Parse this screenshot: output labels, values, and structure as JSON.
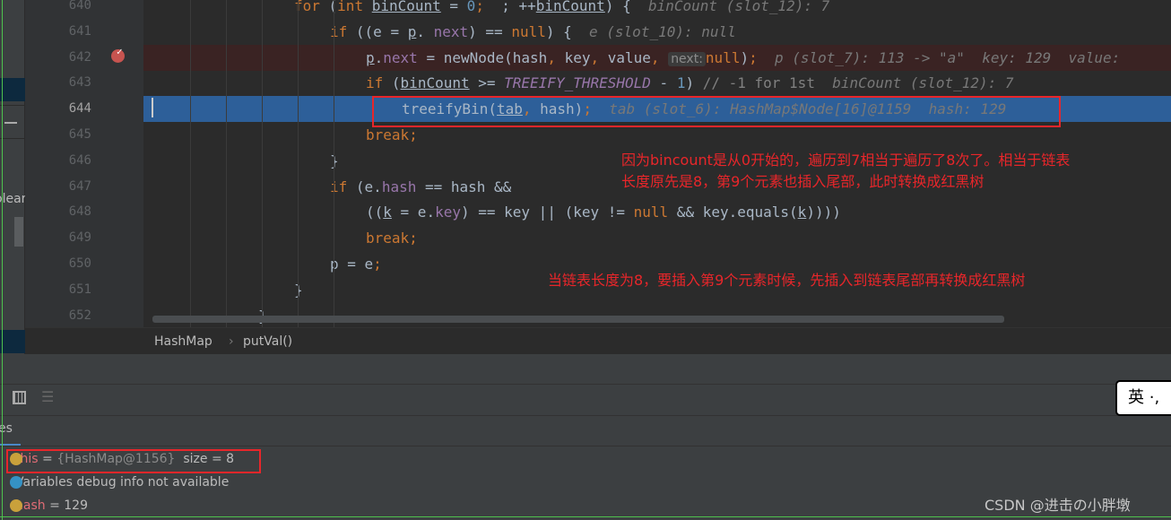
{
  "gutter": {
    "line_numbers": [
      "640",
      "641",
      "642",
      "643",
      "644",
      "645",
      "646",
      "647",
      "648",
      "649",
      "650",
      "651",
      "652"
    ],
    "current_line": "644",
    "breakpoint_line": "642"
  },
  "code_lines": [
    [
      [
        "kw",
        "for "
      ],
      [
        "",
        "("
      ],
      [
        "kw",
        "int "
      ],
      [
        "ul",
        "binCount"
      ],
      [
        "",
        " = "
      ],
      [
        "num",
        "0"
      ],
      [
        "kw",
        "; "
      ],
      [
        "",
        " ; ++"
      ],
      [
        "ul",
        "binCount"
      ],
      [
        "",
        ") {  "
      ],
      [
        "hint",
        "binCount (slot_12): 7"
      ]
    ],
    [
      [
        "kw",
        "if "
      ],
      [
        "",
        "((e = "
      ],
      [
        "ul",
        "p"
      ],
      [
        "",
        ". "
      ],
      [
        "fld",
        "next"
      ],
      [
        "",
        ") == "
      ],
      [
        "kw",
        "null"
      ],
      [
        "",
        ") {  "
      ],
      [
        "hint",
        "e (slot_10): null"
      ]
    ],
    [
      [
        "ul",
        "p"
      ],
      [
        "",
        "."
      ],
      [
        "fld",
        "next"
      ],
      [
        "",
        " = newNode(hash"
      ],
      [
        "kw",
        ", "
      ],
      [
        "",
        "key"
      ],
      [
        "kw",
        ", "
      ],
      [
        "",
        "value"
      ],
      [
        "kw",
        ", "
      ],
      [
        "pill",
        "next:"
      ],
      [
        "kw",
        "null"
      ],
      [
        "",
        ")"
      ],
      [
        "kw",
        ";  "
      ],
      [
        "hint",
        "p (slot_7): 113 -> \"a\"  key: 129  value:"
      ]
    ],
    [
      [
        "kw",
        "if "
      ],
      [
        "",
        "("
      ],
      [
        "ul",
        "binCount"
      ],
      [
        "",
        " >= "
      ],
      [
        "cst",
        "TREEIFY_THRESHOLD"
      ],
      [
        "",
        " - "
      ],
      [
        "num",
        "1"
      ],
      [
        "",
        ") "
      ],
      [
        "cmt",
        "// -1 for 1st  "
      ],
      [
        "hint",
        "binCount (slot_12): 7"
      ]
    ],
    [
      [
        "",
        "treeifyBin("
      ],
      [
        "ul",
        "tab"
      ],
      [
        "kw",
        ", "
      ],
      [
        "",
        "hash)"
      ],
      [
        "kw",
        ";  "
      ],
      [
        "hint",
        "tab (slot_6): HashMap$Node[16]@1159  hash: 129"
      ]
    ],
    [
      [
        "kw",
        "break"
      ],
      [
        "",
        ""
      ],
      [
        "kw",
        ";"
      ]
    ],
    [
      [
        "",
        "}"
      ]
    ],
    [
      [
        "kw",
        "if "
      ],
      [
        "",
        "(e."
      ],
      [
        "fld",
        "hash"
      ],
      [
        "",
        " == hash &&"
      ]
    ],
    [
      [
        "",
        "(("
      ],
      [
        "ul",
        "k"
      ],
      [
        "",
        " = e."
      ],
      [
        "fld",
        "key"
      ],
      [
        "",
        ") == key || (key != "
      ],
      [
        "kw",
        "null"
      ],
      [
        "",
        " && key.equals("
      ],
      [
        "ul",
        "k"
      ],
      [
        "",
        "))))"
      ]
    ],
    [
      [
        "kw",
        "break"
      ],
      [
        "kw",
        ";"
      ]
    ],
    [
      [
        "",
        "p = e"
      ],
      [
        "kw",
        ";"
      ]
    ],
    [
      [
        "",
        "}"
      ]
    ],
    [
      [
        "",
        "}"
      ]
    ]
  ],
  "annotations": {
    "note1_line1": "因为bincount是从0开始的，遍历到7相当于遍历了8次了。相当于链表",
    "note1_line2": "长度原先是8，第9个元素也插入尾部，此时转换成红黑树",
    "note2": "当链表长度为8，要插入第9个元素时候，先插入到链表尾部再转换成红黑树",
    "color": "#e8262a"
  },
  "left_panel": {
    "partial_text": "olear"
  },
  "breadcrumb": {
    "class": "HashMap",
    "separator": "›",
    "method": "putVal()"
  },
  "debug_panel": {
    "tab_partial": "es",
    "variables": [
      {
        "name": "this",
        "eq": " = ",
        "value": "{HashMap@1156}",
        "extra": "  size = 8",
        "icon": "field-icon"
      },
      {
        "name": "",
        "eq": "",
        "value": "",
        "extra": "Variables debug info not available",
        "icon": "info-icon"
      },
      {
        "name": "hash",
        "eq": " = ",
        "value": "",
        "extra": "129",
        "icon": "parameter-icon"
      }
    ]
  },
  "ime": {
    "label": "英 ·,"
  },
  "watermark": "CSDN @进击の小胖墩"
}
